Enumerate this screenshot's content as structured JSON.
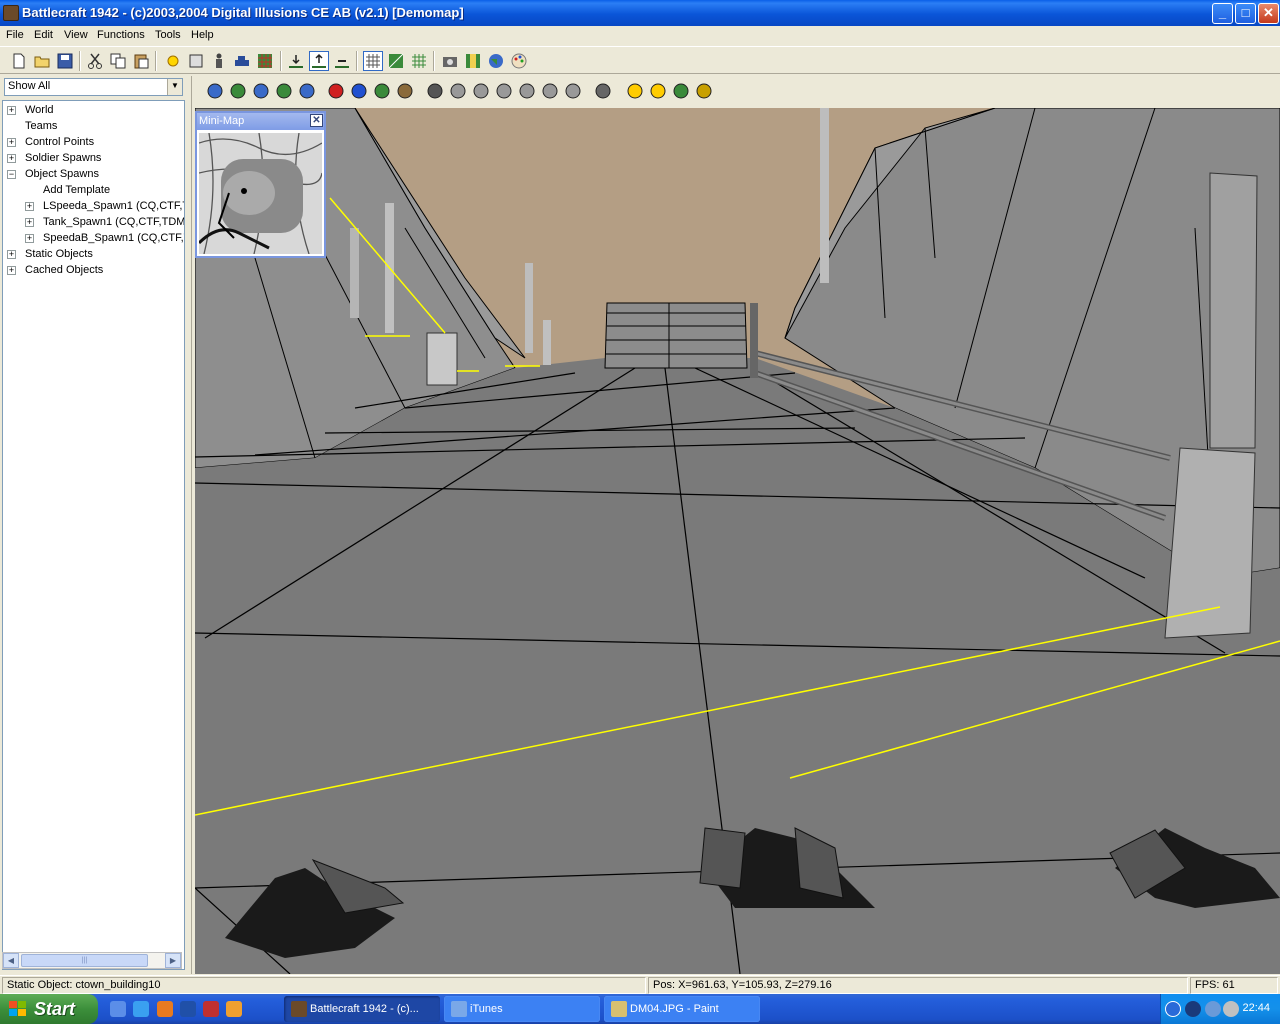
{
  "window": {
    "title": "Battlecraft 1942 - (c)2003,2004 Digital Illusions CE AB (v2.1) [Demomap]",
    "buttons": {
      "minimize": "_",
      "maximize": "□",
      "close": "✕"
    }
  },
  "menu": [
    "File",
    "Edit",
    "View",
    "Functions",
    "Tools",
    "Help"
  ],
  "toolbar1_icons": [
    "new-icon",
    "open-icon",
    "save-icon",
    "cut-icon",
    "copy-icon",
    "paste-icon",
    "light-icon",
    "frame-icon",
    "soldier-icon",
    "vehicle-icon",
    "grid-icon",
    "terrain-lower-icon",
    "terrain-raise-icon",
    "terrain-flatten-icon",
    "wireframe-icon",
    "texture-icon",
    "grid-overlay-icon",
    "camera-icon",
    "map-icon",
    "globe-icon",
    "palette-icon"
  ],
  "toolbar2_icons": [
    "home-icon",
    "pan-icon",
    "orbit-icon",
    "fly-icon",
    "walk-icon",
    "red-cube-icon",
    "blue-cube-icon",
    "tree-icon",
    "objects-icon",
    "select-arrow-icon",
    "move-icon",
    "move-vertical-icon",
    "rotate-icon",
    "rotate-x-icon",
    "rotate-y-icon",
    "scale-icon",
    "snap-icon",
    "lock-icon",
    "lock-all-icon",
    "lock-green-icon",
    "lock-yellow-icon"
  ],
  "filter": {
    "value": "Show All",
    "arrow": "▼"
  },
  "tree": [
    {
      "label": "World",
      "expander": "+",
      "indent": 0
    },
    {
      "label": "Teams",
      "expander": "",
      "indent": 0
    },
    {
      "label": "Control Points",
      "expander": "+",
      "indent": 0
    },
    {
      "label": "Soldier Spawns",
      "expander": "+",
      "indent": 0
    },
    {
      "label": "Object Spawns",
      "expander": "−",
      "indent": 0
    },
    {
      "label": "Add Template",
      "expander": "",
      "indent": 1
    },
    {
      "label": "LSpeeda_Spawn1 (CQ,CTF,T",
      "expander": "+",
      "indent": 1
    },
    {
      "label": "Tank_Spawn1 (CQ,CTF,TDM",
      "expander": "+",
      "indent": 1
    },
    {
      "label": "SpeedaB_Spawn1 (CQ,CTF,T",
      "expander": "+",
      "indent": 1
    },
    {
      "label": "Static Objects",
      "expander": "+",
      "indent": 0
    },
    {
      "label": "Cached Objects",
      "expander": "+",
      "indent": 0
    }
  ],
  "scroll": {
    "left": "◀",
    "right": "▶",
    "grip": "|||"
  },
  "minimap": {
    "title": "Mini-Map",
    "close": "✕"
  },
  "status": {
    "object": "Static Object: ctown_building10",
    "position": "Pos: X=961.63, Y=105.93, Z=279.16",
    "fps": "FPS: 61"
  },
  "taskbar": {
    "start": "Start",
    "tasks": [
      {
        "label": "Battlecraft 1942 - (c)...",
        "active": true
      },
      {
        "label": "iTunes",
        "active": false
      },
      {
        "label": "DM04.JPG - Paint",
        "active": false
      }
    ],
    "clock": "22:44"
  },
  "colors": {
    "sky": "#b49e84",
    "ground": "#7a7a7a",
    "wall": "#8a8a8a",
    "highlight": "#ffff00",
    "title_bar": "#0a55d8",
    "taskbar": "#245edb"
  }
}
